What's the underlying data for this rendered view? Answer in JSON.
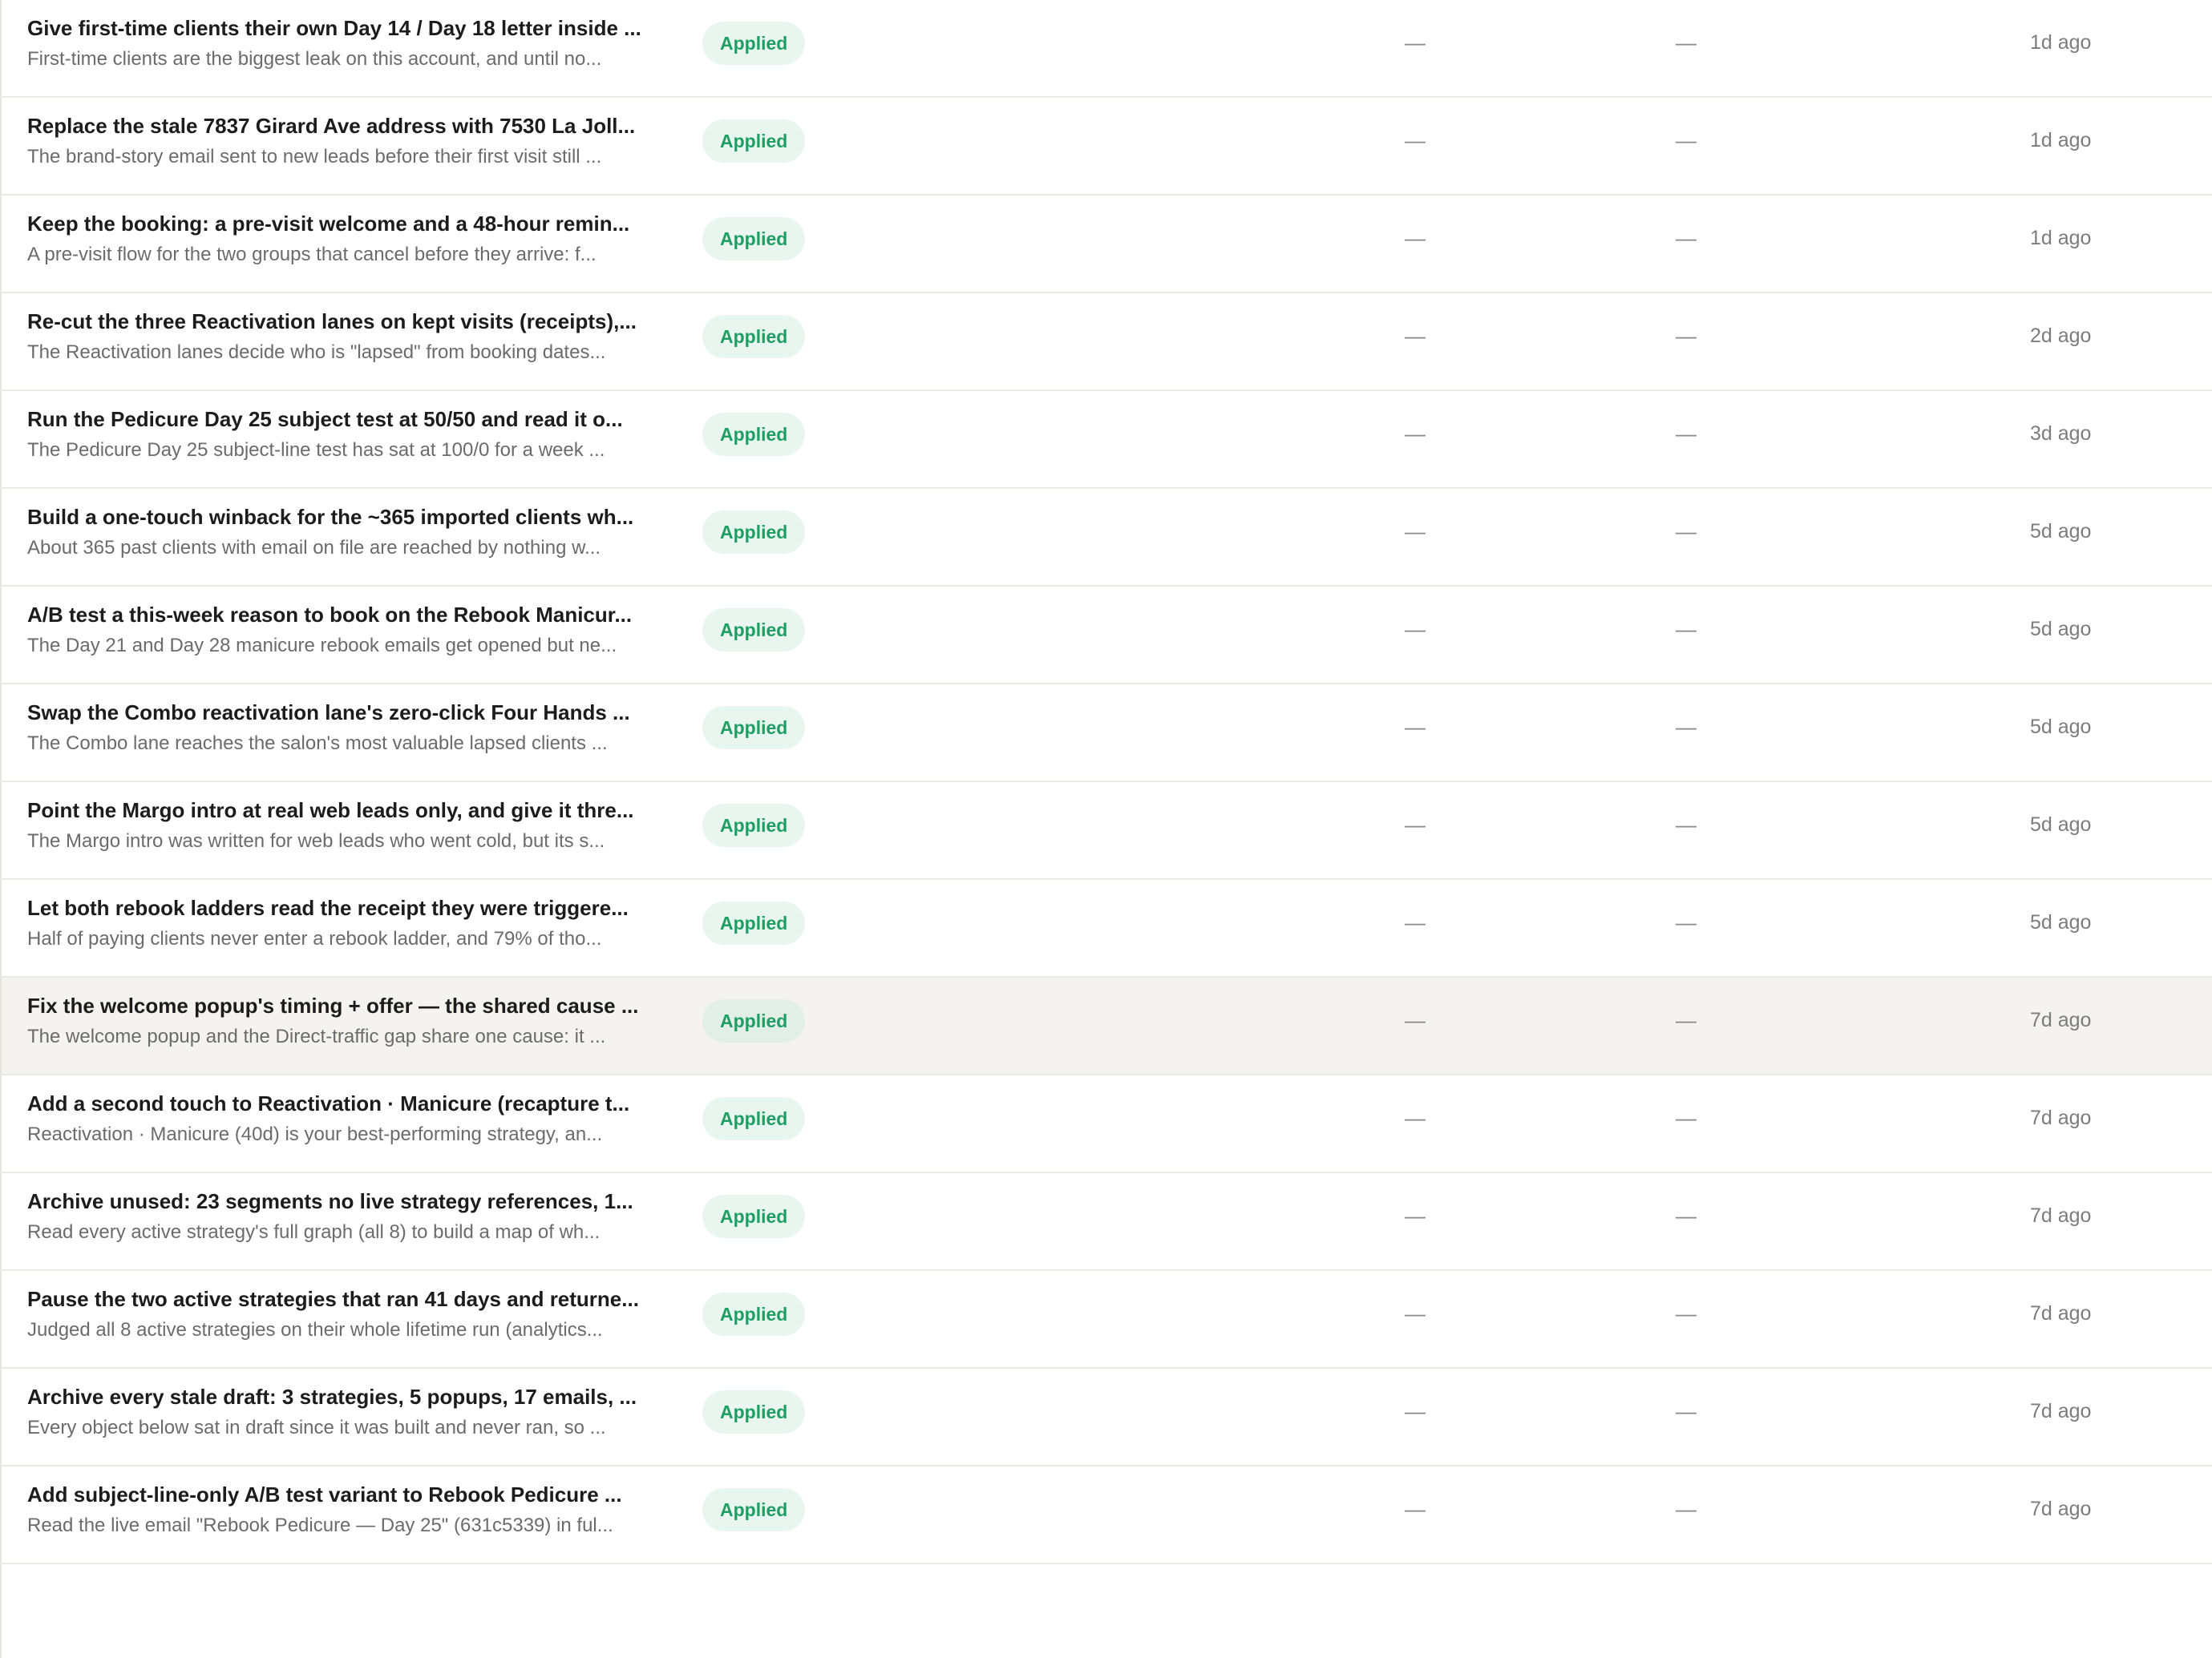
{
  "rows": [
    {
      "title": "Give first-time clients their own Day 14 / Day 18 letter inside ...",
      "desc": "First-time clients are the biggest leak on this account, and until no...",
      "status": "Applied",
      "col_a": "—",
      "col_b": "—",
      "time": "1d ago"
    },
    {
      "title": "Replace the stale 7837 Girard Ave address with 7530 La Joll...",
      "desc": "The brand-story email sent to new leads before their first visit still ...",
      "status": "Applied",
      "col_a": "—",
      "col_b": "—",
      "time": "1d ago"
    },
    {
      "title": "Keep the booking: a pre-visit welcome and a 48-hour remin...",
      "desc": "A pre-visit flow for the two groups that cancel before they arrive: f...",
      "status": "Applied",
      "col_a": "—",
      "col_b": "—",
      "time": "1d ago"
    },
    {
      "title": "Re-cut the three Reactivation lanes on kept visits (receipts),...",
      "desc": "The Reactivation lanes decide who is \"lapsed\" from booking dates...",
      "status": "Applied",
      "col_a": "—",
      "col_b": "—",
      "time": "2d ago"
    },
    {
      "title": "Run the Pedicure Day 25 subject test at 50/50 and read it o...",
      "desc": "The Pedicure Day 25 subject-line test has sat at 100/0 for a week ...",
      "status": "Applied",
      "col_a": "—",
      "col_b": "—",
      "time": "3d ago"
    },
    {
      "title": "Build a one-touch winback for the ~365 imported clients wh...",
      "desc": "About 365 past clients with email on file are reached by nothing w...",
      "status": "Applied",
      "col_a": "—",
      "col_b": "—",
      "time": "5d ago"
    },
    {
      "title": "A/B test a this-week reason to book on the Rebook Manicur...",
      "desc": "The Day 21 and Day 28 manicure rebook emails get opened but ne...",
      "status": "Applied",
      "col_a": "—",
      "col_b": "—",
      "time": "5d ago"
    },
    {
      "title": "Swap the Combo reactivation lane's zero-click Four Hands ...",
      "desc": "The Combo lane reaches the salon's most valuable lapsed clients ...",
      "status": "Applied",
      "col_a": "—",
      "col_b": "—",
      "time": "5d ago"
    },
    {
      "title": "Point the Margo intro at real web leads only, and give it thre...",
      "desc": "The Margo intro was written for web leads who went cold, but its s...",
      "status": "Applied",
      "col_a": "—",
      "col_b": "—",
      "time": "5d ago"
    },
    {
      "title": "Let both rebook ladders read the receipt they were triggere...",
      "desc": "Half of paying clients never enter a rebook ladder, and 79% of tho...",
      "status": "Applied",
      "col_a": "—",
      "col_b": "—",
      "time": "5d ago"
    },
    {
      "title": "Fix the welcome popup's timing + offer — the shared cause ...",
      "desc": "The welcome popup and the Direct-traffic gap share one cause: it ...",
      "status": "Applied",
      "col_a": "—",
      "col_b": "—",
      "time": "7d ago"
    },
    {
      "title": "Add a second touch to Reactivation · Manicure (recapture t...",
      "desc": "Reactivation · Manicure (40d) is your best-performing strategy, an...",
      "status": "Applied",
      "col_a": "—",
      "col_b": "—",
      "time": "7d ago"
    },
    {
      "title": "Archive unused: 23 segments no live strategy references, 1...",
      "desc": "Read every active strategy's full graph (all 8) to build a map of wh...",
      "status": "Applied",
      "col_a": "—",
      "col_b": "—",
      "time": "7d ago"
    },
    {
      "title": "Pause the two active strategies that ran 41 days and returne...",
      "desc": "Judged all 8 active strategies on their whole lifetime run (analytics...",
      "status": "Applied",
      "col_a": "—",
      "col_b": "—",
      "time": "7d ago"
    },
    {
      "title": "Archive every stale draft: 3 strategies, 5 popups, 17 emails, ...",
      "desc": "Every object below sat in draft since it was built and never ran, so ...",
      "status": "Applied",
      "col_a": "—",
      "col_b": "—",
      "time": "7d ago"
    },
    {
      "title": "Add subject-line-only A/B test variant to Rebook Pedicure ...",
      "desc": "Read the live email \"Rebook Pedicure — Day 25\" (631c5339) in ful...",
      "status": "Applied",
      "col_a": "—",
      "col_b": "—",
      "time": "7d ago"
    }
  ]
}
